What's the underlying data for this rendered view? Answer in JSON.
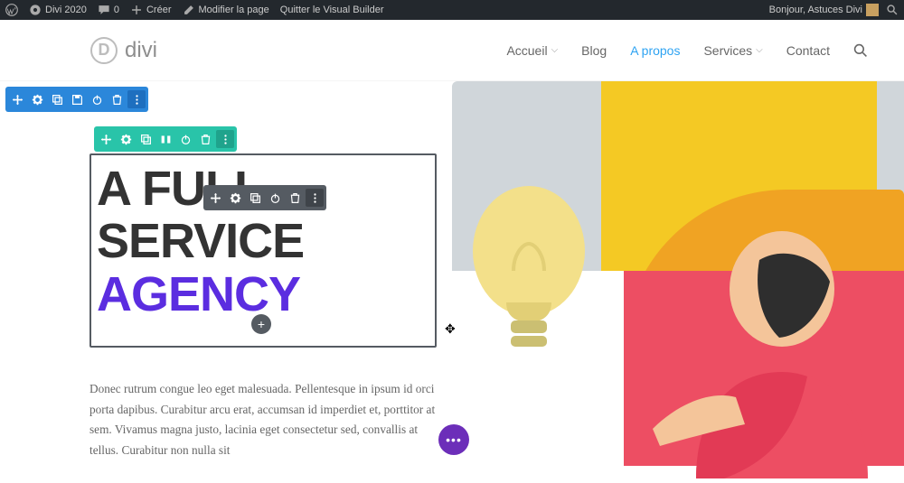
{
  "wp_bar": {
    "site_name": "Divi 2020",
    "comment_count": "0",
    "create_label": "Créer",
    "edit_page_label": "Modifier la page",
    "quit_vb_label": "Quitter le Visual Builder",
    "greeting": "Bonjour, Astuces Divi"
  },
  "logo": {
    "letter": "D",
    "text": "divi"
  },
  "nav": {
    "home": "Accueil",
    "blog": "Blog",
    "about": "A propos",
    "services": "Services",
    "contact": "Contact"
  },
  "headline": {
    "line1": "A FULL",
    "line2": "SERVICE",
    "line3_accent": "AGENCY"
  },
  "body_text": "Donec rutrum congue leo eget malesuada. Pellentesque in ipsum id orci porta dapibus. Curabitur arcu erat, accumsan id imperdiet et, porttitor at sem. Vivamus magna justo, lacinia eget consectetur sed, convallis at tellus. Curabitur non nulla sit",
  "fab_label": "•••",
  "plus_label": "+",
  "colors": {
    "accent_link": "#2ea3f2",
    "accent_headline": "#5b2de0",
    "section_toolbar": "#2b87da",
    "row_toolbar": "#29c4a9",
    "module_toolbar": "#555b62",
    "fab": "#6c2eb9"
  },
  "icons": {
    "move": "move-icon",
    "settings": "gear-icon",
    "duplicate": "duplicate-icon",
    "columns": "columns-icon",
    "save": "save-icon",
    "power": "power-icon",
    "delete": "trash-icon",
    "more": "more-vertical-icon"
  }
}
